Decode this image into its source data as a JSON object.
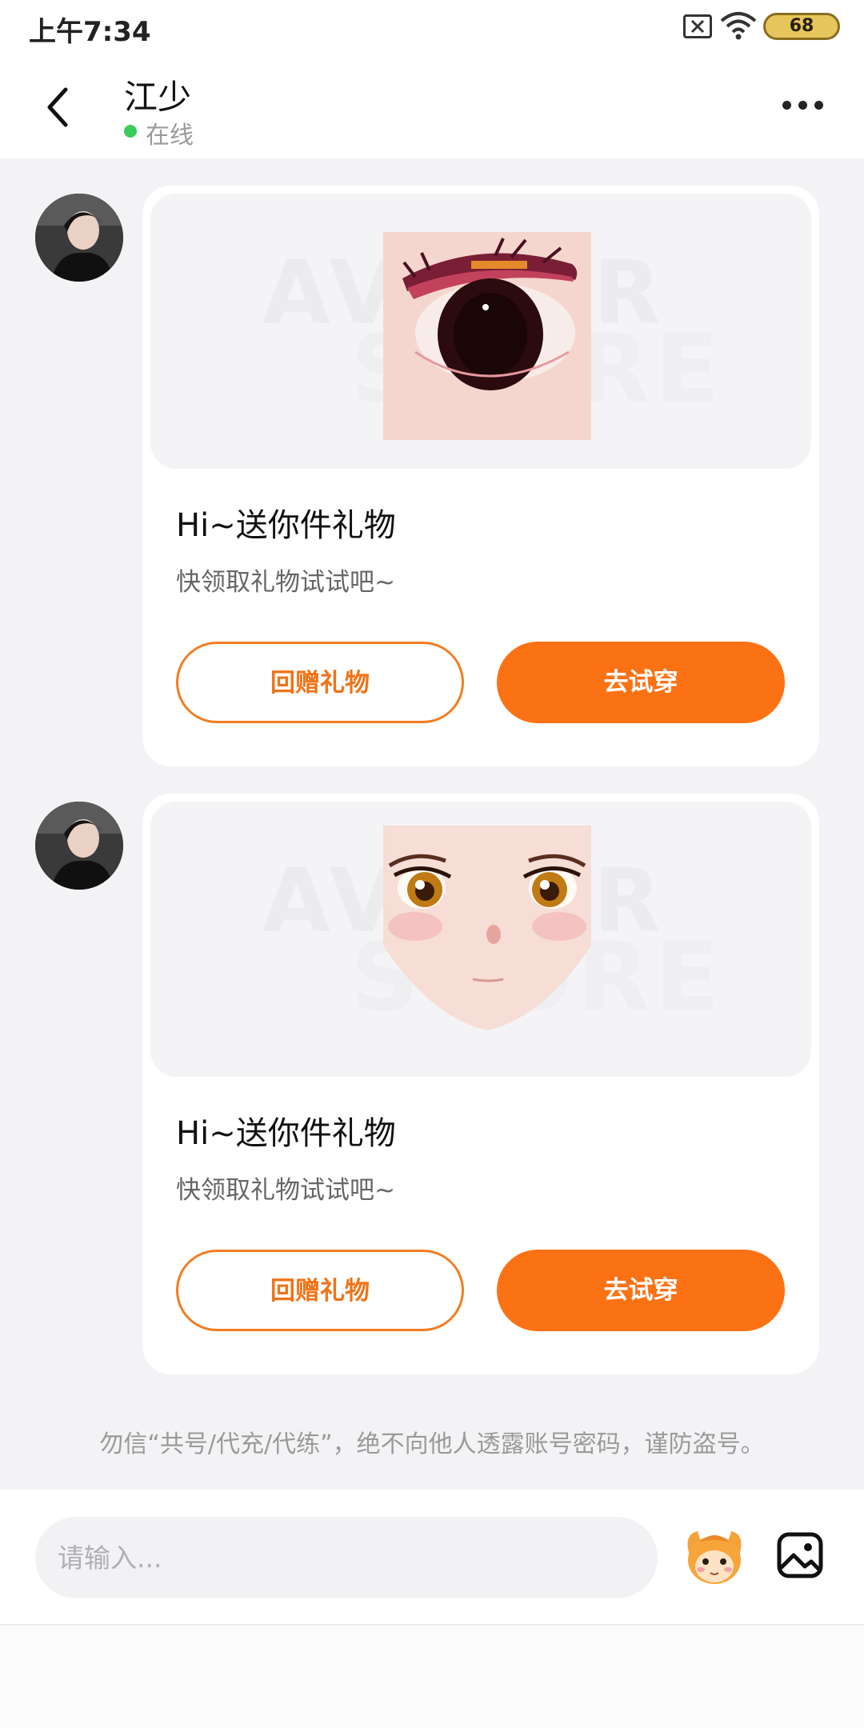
{
  "status_bar": {
    "time": "上午7:34",
    "battery": "68",
    "icons": [
      "sim-off-icon",
      "wifi-icon",
      "battery-icon"
    ]
  },
  "header": {
    "contact_name": "江少",
    "status": "在线",
    "back_icon": "chevron-left-icon",
    "more_icon": "more-dots-icon"
  },
  "messages": [
    {
      "gift_preview": "eye-texture",
      "title": "Hi~送你件礼物",
      "subtitle": "快领取礼物试试吧~",
      "return_gift_label": "回赠礼物",
      "try_on_label": "去试穿"
    },
    {
      "gift_preview": "anime-face",
      "title": "Hi~送你件礼物",
      "subtitle": "快领取礼物试试吧~",
      "return_gift_label": "回赠礼物",
      "try_on_label": "去试穿"
    }
  ],
  "safety_notice": "勿信“共号/代充/代练”，绝不向他人透露账号密码，谨防盗号。",
  "composer": {
    "placeholder": "请输入...",
    "emoji_icon": "emoji-mascot-icon",
    "image_icon": "image-picker-icon"
  },
  "colors": {
    "accent": "#fb7214",
    "online": "#3bcc5a",
    "background": "#f3f3f6"
  }
}
